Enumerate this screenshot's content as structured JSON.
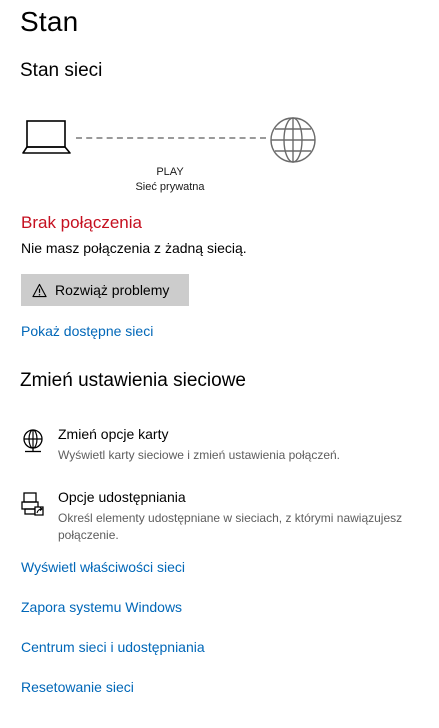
{
  "page": {
    "title": "Stan"
  },
  "network_status": {
    "heading": "Stan sieci",
    "network_name": "PLAY",
    "network_type": "Sieć prywatna",
    "status": "Brak połączenia",
    "status_description": "Nie masz połączenia z żadną siecią.",
    "troubleshoot_label": "Rozwiąż problemy",
    "show_networks_link": "Pokaż dostępne sieci",
    "status_color": "#c50f1f",
    "link_color": "#0067b8"
  },
  "change_settings": {
    "heading": "Zmień ustawienia sieciowe",
    "options": [
      {
        "icon": "network-adapter-icon",
        "title": "Zmień opcje karty",
        "description": "Wyświetl karty sieciowe i zmień ustawienia połączeń."
      },
      {
        "icon": "sharing-options-icon",
        "title": "Opcje udostępniania",
        "description": "Określ elementy udostępniane w sieciach, z którymi nawiązujesz połączenie."
      }
    ]
  },
  "links": [
    "Wyświetl właściwości sieci",
    "Zapora systemu Windows",
    "Centrum sieci i udostępniania",
    "Resetowanie sieci"
  ]
}
